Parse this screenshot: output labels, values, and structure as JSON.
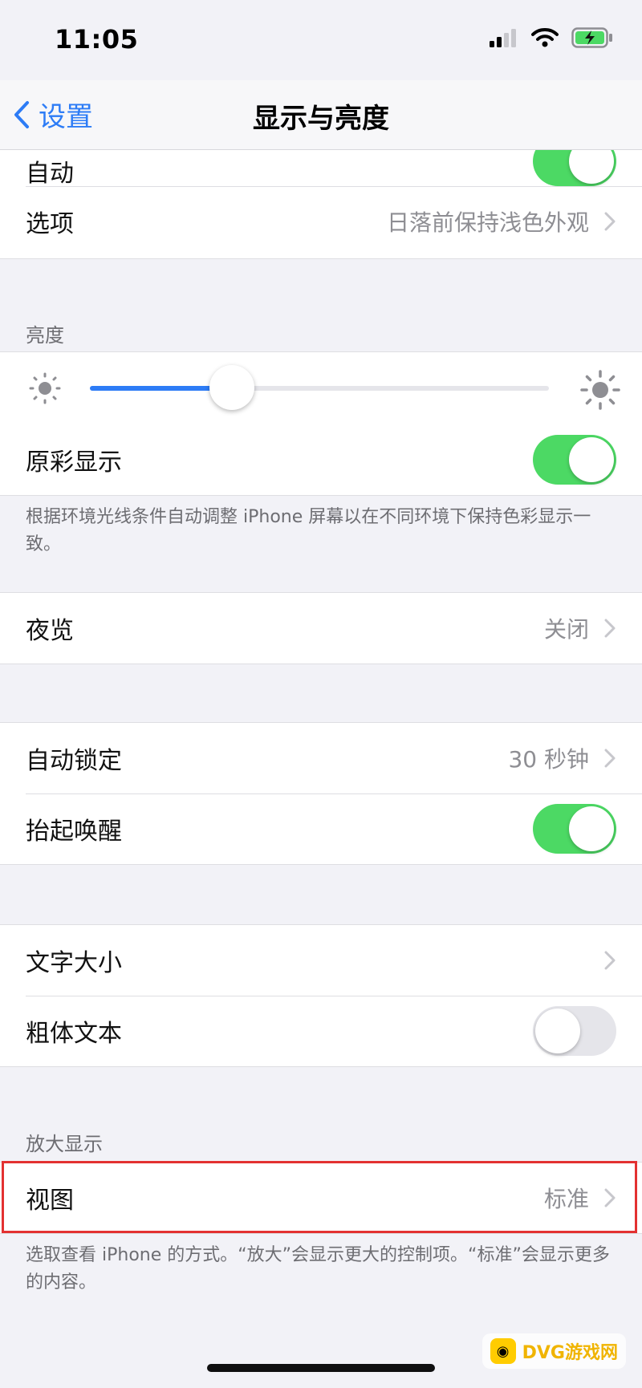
{
  "status_bar": {
    "time": "11:05",
    "signal_icon": "signal-icon",
    "wifi_icon": "wifi-icon",
    "battery_icon": "battery-charging-icon"
  },
  "nav": {
    "back_label": "设置",
    "title": "显示与亮度"
  },
  "appearance_group": {
    "auto_label": "自动",
    "auto_enabled": true,
    "options_label": "选项",
    "options_value": "日落前保持浅色外观"
  },
  "brightness": {
    "header": "亮度",
    "level_percent": 31,
    "true_tone_label": "原彩显示",
    "true_tone_enabled": true,
    "footnote": "根据环境光线条件自动调整 iPhone 屏幕以在不同环境下保持色彩显示一致。"
  },
  "night_shift": {
    "label": "夜览",
    "value": "关闭"
  },
  "lock_group": {
    "auto_lock_label": "自动锁定",
    "auto_lock_value": "30 秒钟",
    "raise_to_wake_label": "抬起唤醒",
    "raise_to_wake_enabled": true
  },
  "text_group": {
    "text_size_label": "文字大小",
    "bold_text_label": "粗体文本",
    "bold_text_enabled": false
  },
  "zoom": {
    "header": "放大显示",
    "view_label": "视图",
    "view_value": "标准",
    "footnote": "选取查看 iPhone 的方式。“放大”会显示更大的控制项。“标准”会显示更多的内容。"
  },
  "watermark": {
    "text": "DVG游戏网"
  },
  "colors": {
    "accent": "#2d7cf6",
    "toggle_on": "#4cd964",
    "highlight": "#e33131"
  }
}
